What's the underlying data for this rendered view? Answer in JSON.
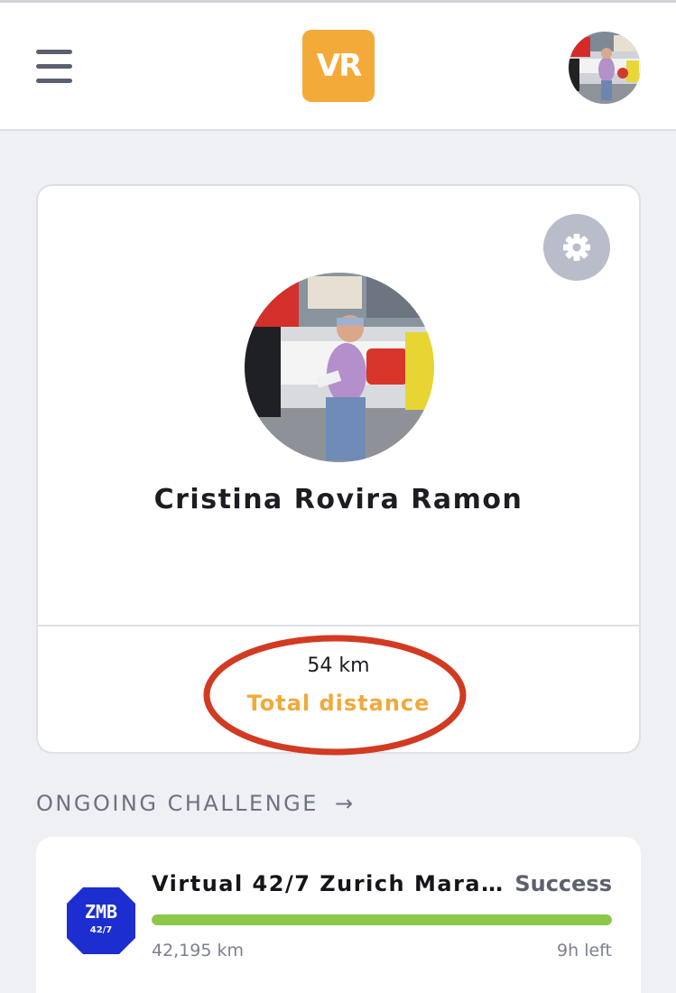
{
  "colors": {
    "background": "#eef0f3",
    "brand_orange": "#f3aa38",
    "progress_green": "#8cc84a",
    "highlight_red": "#d23a22"
  },
  "header": {
    "menu_icon": "hamburger-menu-icon",
    "logo_text": "VR",
    "avatar_icon": "user-avatar-photo"
  },
  "profile": {
    "name": "Cristina Rovira Ramon",
    "settings_icon": "gear-icon",
    "total_distance_value": "54 km",
    "total_distance_label": "Total distance"
  },
  "ongoing": {
    "section_title": "ONGOING CHALLENGE",
    "arrow_icon": "arrow-right-icon",
    "challenge": {
      "badge_text": "ZMB",
      "badge_subtext": "42/7",
      "title": "Virtual 42/7 Zurich Marat...",
      "status": "Success",
      "progress_fraction": 1.0,
      "distance": "42,195 km",
      "time_left": "9h left"
    }
  }
}
